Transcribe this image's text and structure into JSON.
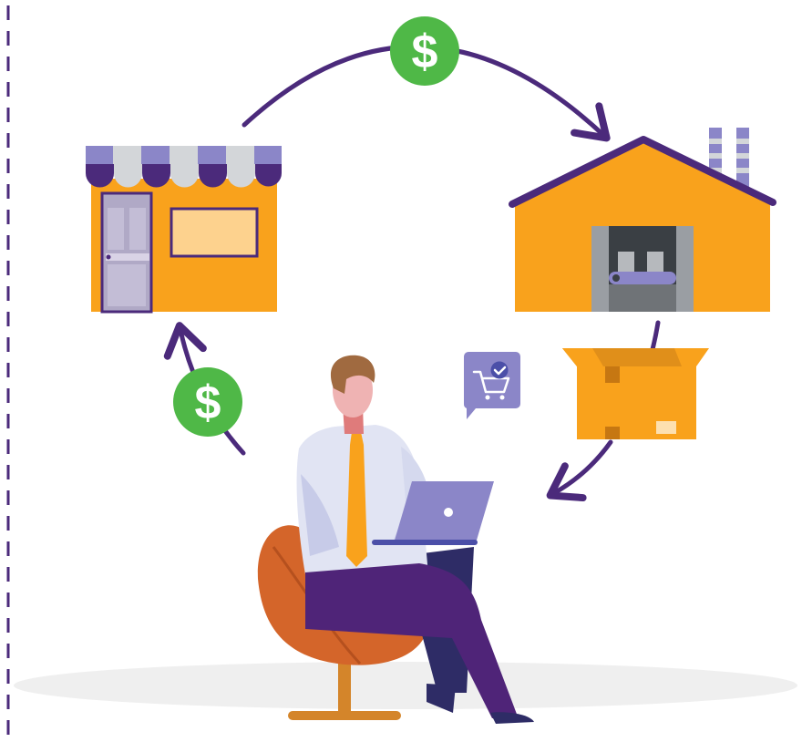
{
  "colors": {
    "primary": "#4b2a7b",
    "orange": "#f9a21c",
    "green": "#4fb847",
    "lavender": "#8b86c8",
    "chair": "#d4652a",
    "shadow": "#efefef"
  },
  "coins": [
    {
      "symbol": "$"
    },
    {
      "symbol": "$"
    }
  ],
  "icons": {
    "shop": "storefront-icon",
    "warehouse": "warehouse-icon",
    "box": "package-box-icon",
    "cart": "shopping-cart-chat-icon",
    "person": "businessman-with-laptop-icon"
  }
}
